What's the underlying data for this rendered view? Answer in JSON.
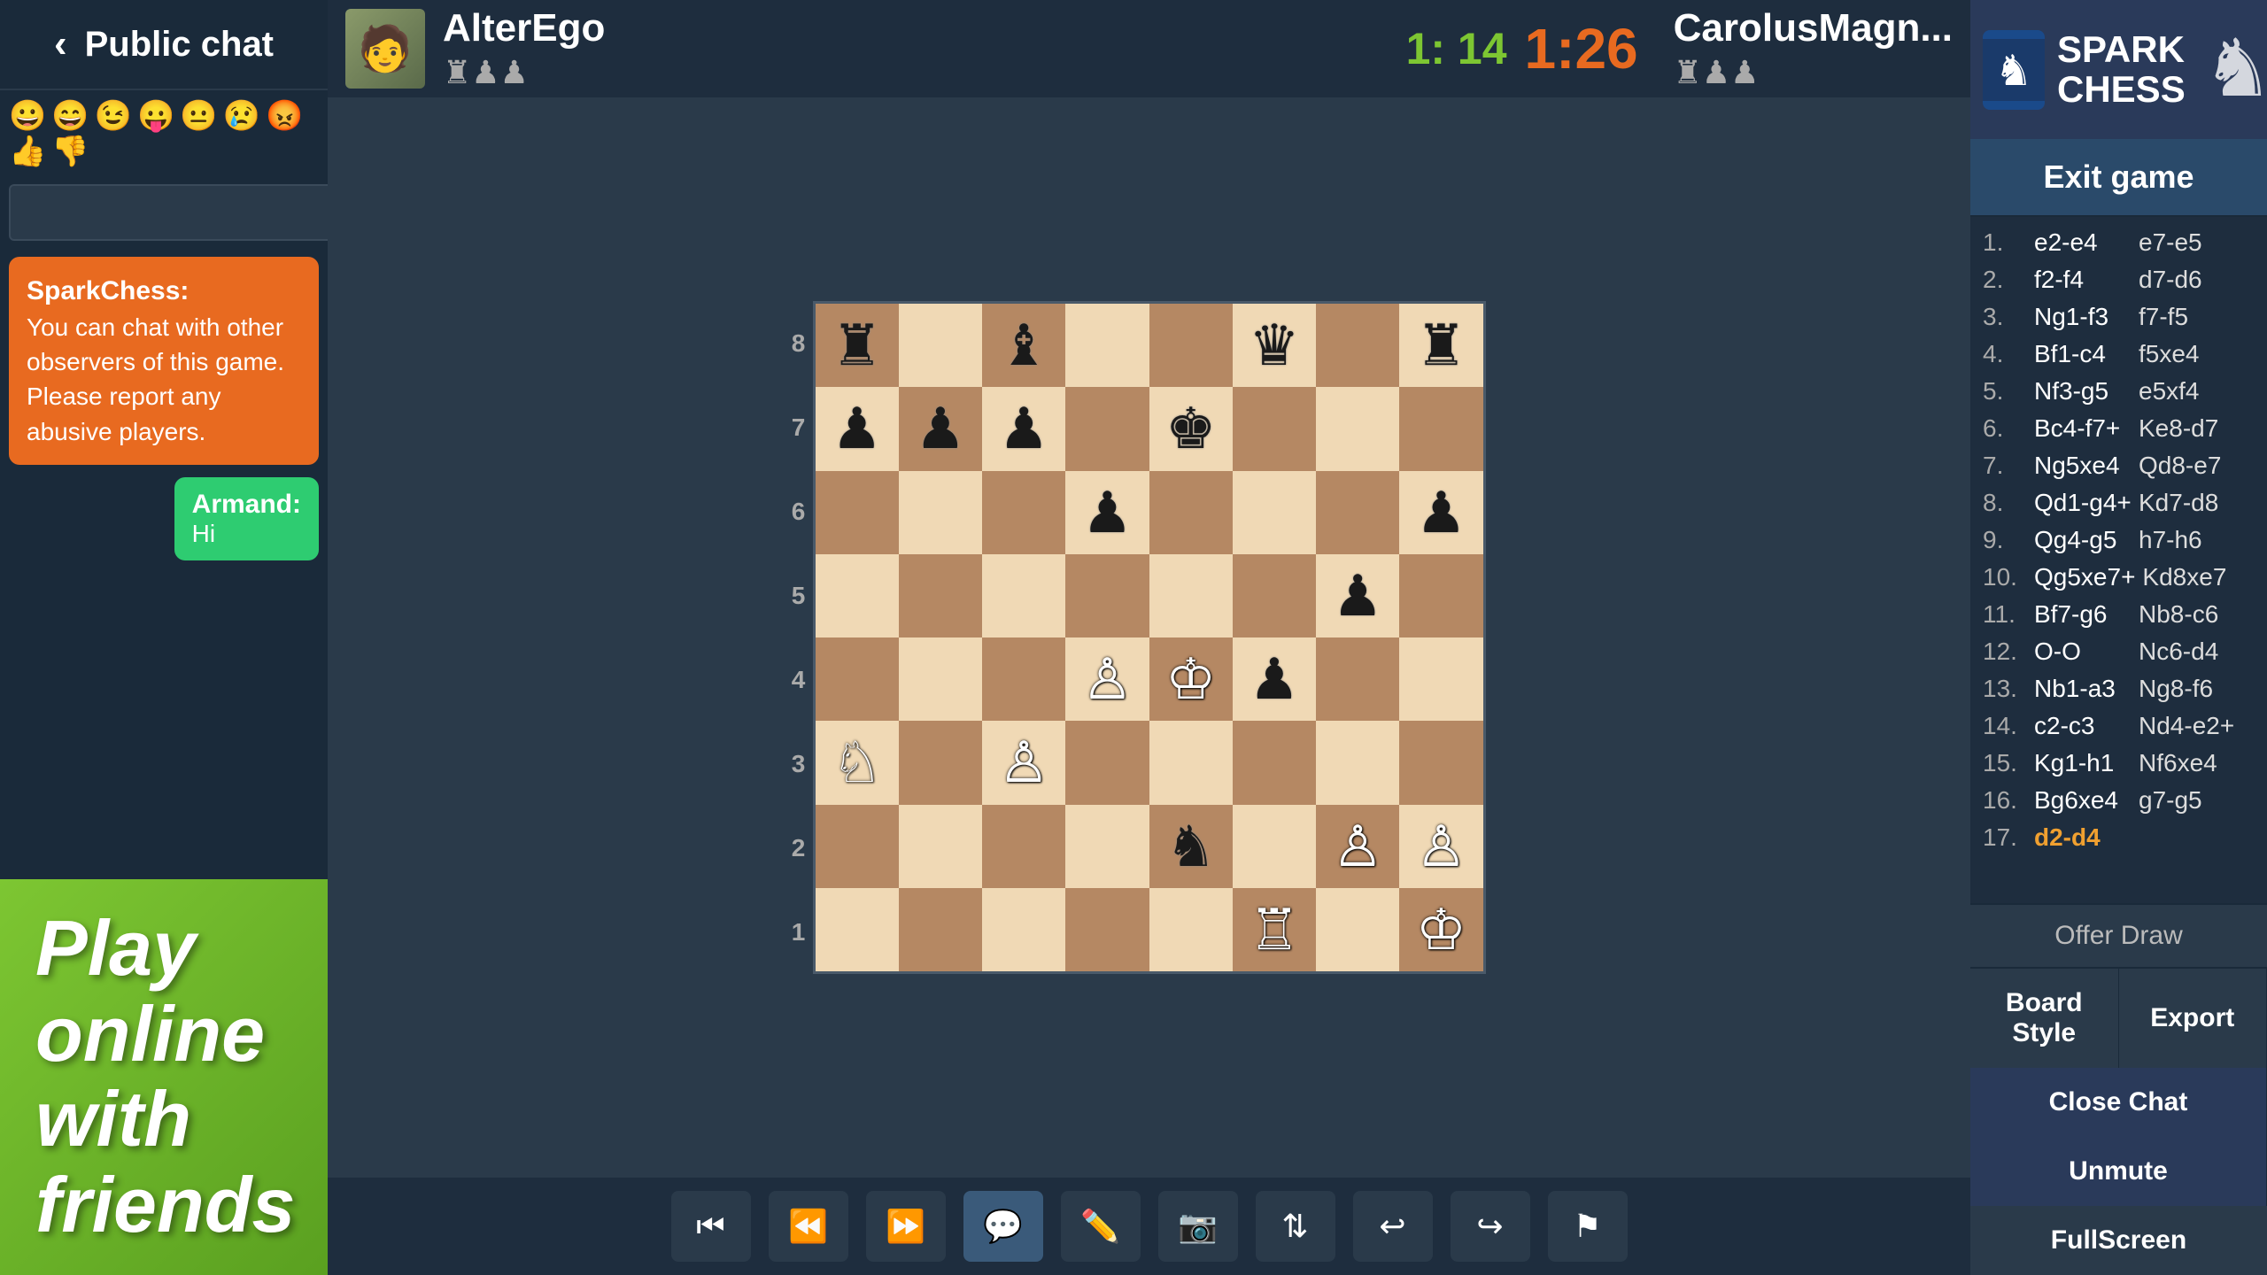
{
  "chat": {
    "title": "Public chat",
    "back_label": "‹",
    "emojis": [
      "😀",
      "😄",
      "😉",
      "😛",
      "😐",
      "😢",
      "😡",
      "👍",
      "👎"
    ],
    "input_placeholder": "",
    "send_label": "▶",
    "messages": [
      {
        "type": "system",
        "sender": "SparkChess:",
        "text": "You can chat with other observers of this game. Please report any abusive players."
      },
      {
        "type": "user",
        "sender": "Armand:",
        "text": "Hi"
      }
    ]
  },
  "promo": {
    "line1": "Play online",
    "line2": "with friends"
  },
  "game_header": {
    "player1_name": "AlterEgo",
    "player1_pieces": "♜♟♟",
    "score_white": "1: 14",
    "timer": "1:26",
    "player2_name": "CarolusMagn...",
    "player2_pieces": "♜♟♟"
  },
  "board": {
    "pieces": [
      {
        "rank": 8,
        "file": 1,
        "piece": "♜",
        "color": "black"
      },
      {
        "rank": 8,
        "file": 3,
        "piece": "♝",
        "color": "black"
      },
      {
        "rank": 8,
        "file": 6,
        "piece": "♛",
        "color": "black"
      },
      {
        "rank": 8,
        "file": 8,
        "piece": "♜",
        "color": "black"
      },
      {
        "rank": 7,
        "file": 1,
        "piece": "♟",
        "color": "black"
      },
      {
        "rank": 7,
        "file": 2,
        "piece": "♟",
        "color": "black"
      },
      {
        "rank": 7,
        "file": 3,
        "piece": "♟",
        "color": "black"
      },
      {
        "rank": 7,
        "file": 5,
        "piece": "♚",
        "color": "black"
      },
      {
        "rank": 6,
        "file": 4,
        "piece": "♟",
        "color": "black"
      },
      {
        "rank": 6,
        "file": 8,
        "piece": "♟",
        "color": "black"
      },
      {
        "rank": 5,
        "file": 7,
        "piece": "♟",
        "color": "black"
      },
      {
        "rank": 4,
        "file": 4,
        "piece": "♙",
        "color": "white"
      },
      {
        "rank": 4,
        "file": 5,
        "piece": "♔",
        "color": "white"
      },
      {
        "rank": 4,
        "file": 6,
        "piece": "♟",
        "color": "black"
      },
      {
        "rank": 3,
        "file": 1,
        "piece": "♘",
        "color": "white"
      },
      {
        "rank": 3,
        "file": 3,
        "piece": "♙",
        "color": "white"
      },
      {
        "rank": 2,
        "file": 5,
        "piece": "♞",
        "color": "black"
      },
      {
        "rank": 2,
        "file": 7,
        "piece": "♙",
        "color": "white"
      },
      {
        "rank": 2,
        "file": 8,
        "piece": "♙",
        "color": "white"
      },
      {
        "rank": 1,
        "file": 6,
        "piece": "♖",
        "color": "white"
      },
      {
        "rank": 1,
        "file": 8,
        "piece": "♔",
        "color": "white"
      }
    ],
    "ranks": [
      "8",
      "7",
      "6",
      "5",
      "4",
      "3",
      "2",
      "1"
    ]
  },
  "controls": [
    {
      "id": "chat",
      "icon": "💬",
      "label": "chat"
    },
    {
      "id": "edit",
      "icon": "✏️",
      "label": "edit"
    },
    {
      "id": "camera",
      "icon": "📷",
      "label": "camera"
    },
    {
      "id": "swap",
      "icon": "⇅",
      "label": "swap"
    },
    {
      "id": "undo",
      "icon": "↩",
      "label": "undo"
    },
    {
      "id": "redo",
      "icon": "↪",
      "label": "redo"
    },
    {
      "id": "flag",
      "icon": "⚑",
      "label": "flag"
    }
  ],
  "sidebar": {
    "logo_text": "SPARK\nCHESS",
    "exit_label": "Exit game",
    "moves": [
      {
        "num": "1.",
        "white": "e2-e4",
        "black": "e7-e5"
      },
      {
        "num": "2.",
        "white": "f2-f4",
        "black": "d7-d6"
      },
      {
        "num": "3.",
        "white": "Ng1-f3",
        "black": "f7-f5"
      },
      {
        "num": "4.",
        "white": "Bf1-c4",
        "black": "f5xe4"
      },
      {
        "num": "5.",
        "white": "Nf3-g5",
        "black": "e5xf4"
      },
      {
        "num": "6.",
        "white": "Bc4-f7+",
        "black": "Ke8-d7"
      },
      {
        "num": "7.",
        "white": "Ng5xe4",
        "black": "Qd8-e7"
      },
      {
        "num": "8.",
        "white": "Qd1-g4+",
        "black": "Kd7-d8"
      },
      {
        "num": "9.",
        "white": "Qg4-g5",
        "black": "h7-h6"
      },
      {
        "num": "10.",
        "white": "Qg5xe7+",
        "black": "Kd8xe7"
      },
      {
        "num": "11.",
        "white": "Bf7-g6",
        "black": "Nb8-c6"
      },
      {
        "num": "12.",
        "white": "O-O",
        "black": "Nc6-d4"
      },
      {
        "num": "13.",
        "white": "Nb1-a3",
        "black": "Ng8-f6"
      },
      {
        "num": "14.",
        "white": "c2-c3",
        "black": "Nd4-e2+"
      },
      {
        "num": "15.",
        "white": "Kg1-h1",
        "black": "Nf6xe4"
      },
      {
        "num": "16.",
        "white": "Bg6xe4",
        "black": "g7-g5"
      },
      {
        "num": "17.",
        "white": "d2-d4",
        "black": "",
        "highlight_white": true
      }
    ],
    "offer_draw_label": "Offer Draw",
    "board_style_label": "Board Style",
    "export_label": "Export",
    "close_chat_label": "Close Chat",
    "unmute_label": "Unmute",
    "fullscreen_label": "FullScreen"
  }
}
